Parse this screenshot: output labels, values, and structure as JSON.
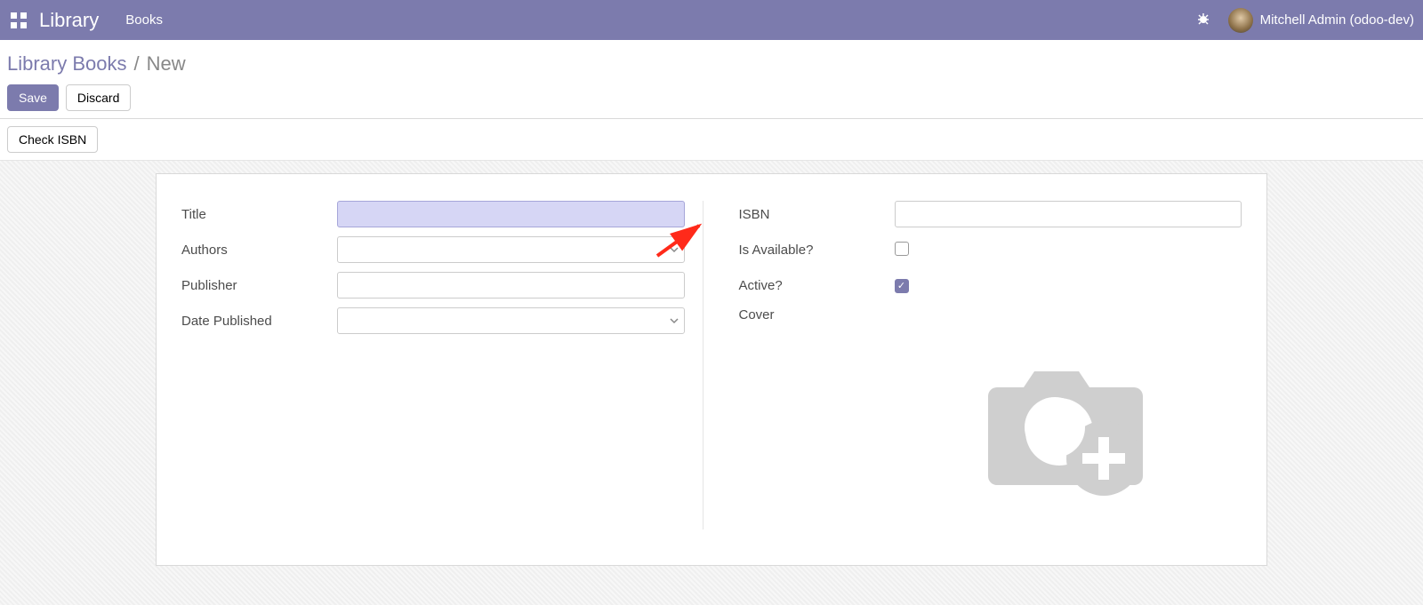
{
  "navbar": {
    "brand": "Library",
    "menu_books": "Books",
    "user": "Mitchell Admin (odoo-dev)"
  },
  "breadcrumb": {
    "parent": "Library Books",
    "separator": "/",
    "current": "New"
  },
  "buttons": {
    "save": "Save",
    "discard": "Discard",
    "check_isbn": "Check ISBN"
  },
  "form": {
    "left": {
      "title_label": "Title",
      "title_value": "",
      "authors_label": "Authors",
      "authors_value": "",
      "publisher_label": "Publisher",
      "publisher_value": "",
      "date_published_label": "Date Published",
      "date_published_value": ""
    },
    "right": {
      "isbn_label": "ISBN",
      "isbn_value": "",
      "is_available_label": "Is Available?",
      "is_available_value": false,
      "active_label": "Active?",
      "active_value": true,
      "cover_label": "Cover"
    }
  }
}
